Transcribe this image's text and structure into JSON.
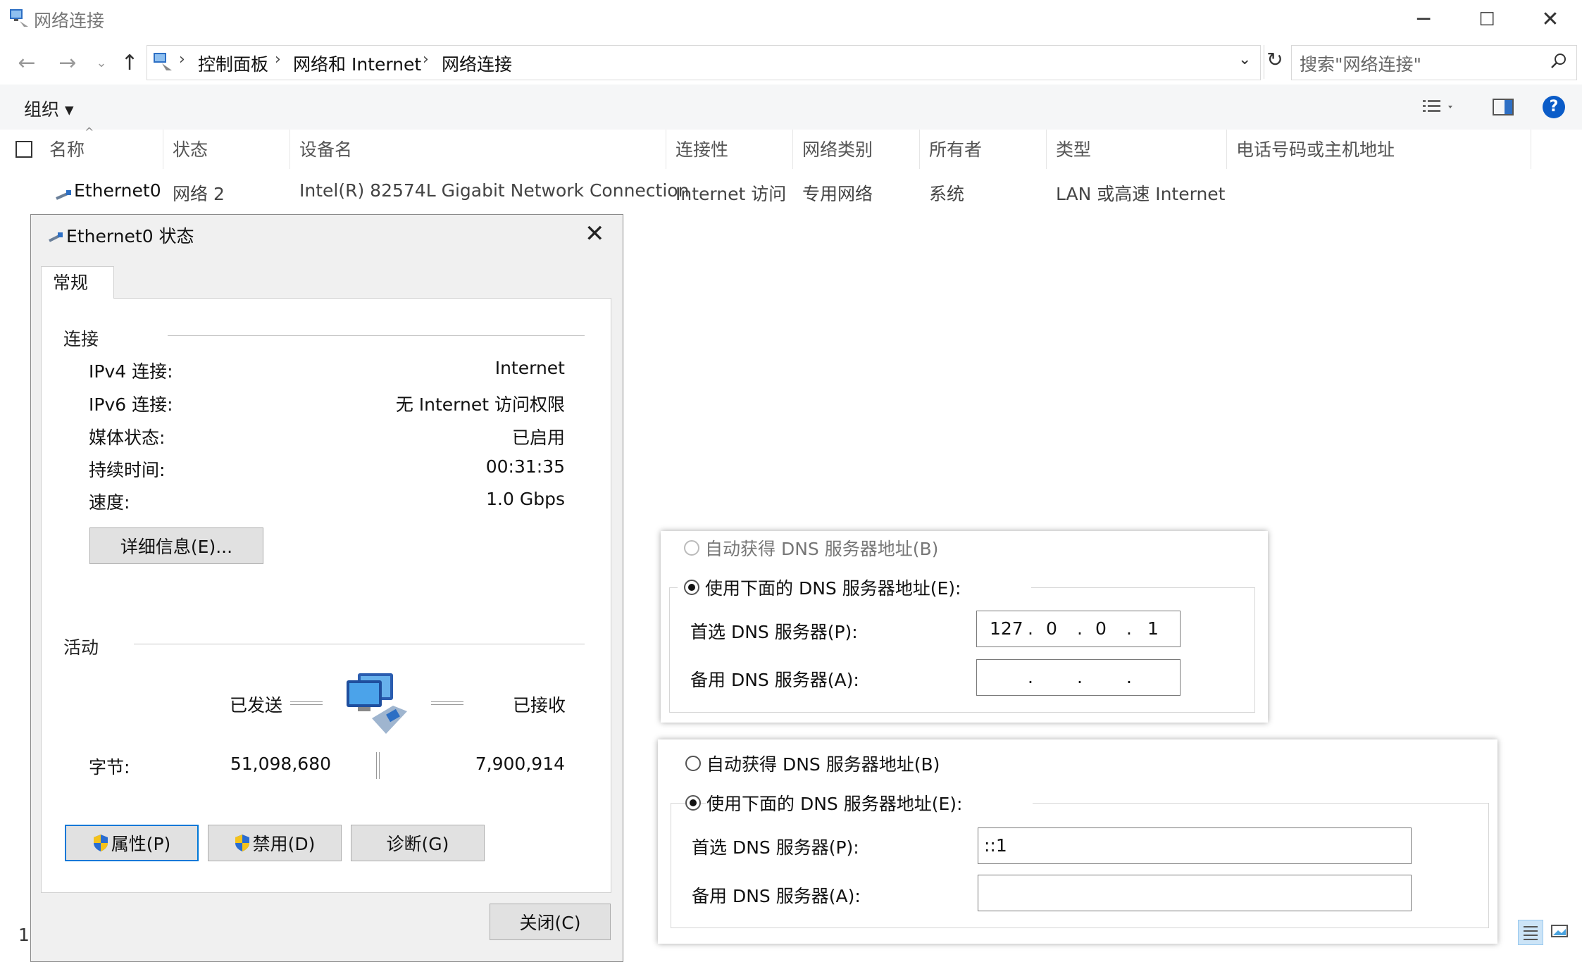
{
  "window": {
    "title": "网络连接",
    "minimize": "─",
    "maximize": "☐",
    "close": "✕"
  },
  "address": {
    "crumbs": [
      "控制面板",
      "网络和 Internet",
      "网络连接"
    ],
    "search_placeholder": "搜索\"网络连接\""
  },
  "toolbar": {
    "organize": "组织 ▾",
    "help": "?"
  },
  "columns": [
    "名称",
    "状态",
    "设备名",
    "连接性",
    "网络类别",
    "所有者",
    "类型",
    "电话号码或主机地址"
  ],
  "rows": [
    {
      "name": "Ethernet0",
      "status": "网络 2",
      "device": "Intel(R) 82574L Gigabit Network Connection",
      "connectivity": "Internet 访问",
      "category": "专用网络",
      "owner": "系统",
      "type": "LAN 或高速 Internet"
    }
  ],
  "status_dialog": {
    "title": "Ethernet0 状态",
    "tab": "常规",
    "connection_section": "连接",
    "fields": [
      {
        "label": "IPv4 连接:",
        "value": "Internet"
      },
      {
        "label": "IPv6 连接:",
        "value": "无 Internet 访问权限"
      },
      {
        "label": "媒体状态:",
        "value": "已启用"
      },
      {
        "label": "持续时间:",
        "value": "00:31:35"
      },
      {
        "label": "速度:",
        "value": "1.0 Gbps"
      }
    ],
    "details_button": "详细信息(E)...",
    "activity_section": "活动",
    "sent_label": "已发送",
    "received_label": "已接收",
    "bytes_label": "字节:",
    "bytes_sent": "51,098,680",
    "bytes_received": "7,900,914",
    "properties_button": "属性(P)",
    "disable_button": "禁用(D)",
    "diagnose_button": "诊断(G)",
    "close_button": "关闭(C)"
  },
  "dns_ipv4": {
    "auto_label": "自动获得 DNS 服务器地址(B)",
    "manual_label": "使用下面的 DNS 服务器地址(E):",
    "preferred_label": "首选 DNS 服务器(P):",
    "alternate_label": "备用 DNS 服务器(A):",
    "preferred_octets": [
      "127",
      "0",
      "0",
      "1"
    ],
    "dot": "."
  },
  "dns_ipv6": {
    "auto_label": "自动获得 DNS 服务器地址(B)",
    "manual_label": "使用下面的 DNS 服务器地址(E):",
    "preferred_label": "首选 DNS 服务器(P):",
    "alternate_label": "备用 DNS 服务器(A):",
    "preferred_value": "::1",
    "alternate_value": ""
  },
  "footer": {
    "item_count": "1"
  },
  "colors": {
    "accent": "#0078d7",
    "toolbar_bg": "#f5f6f7",
    "dialog_bg": "#f0f0f0"
  }
}
